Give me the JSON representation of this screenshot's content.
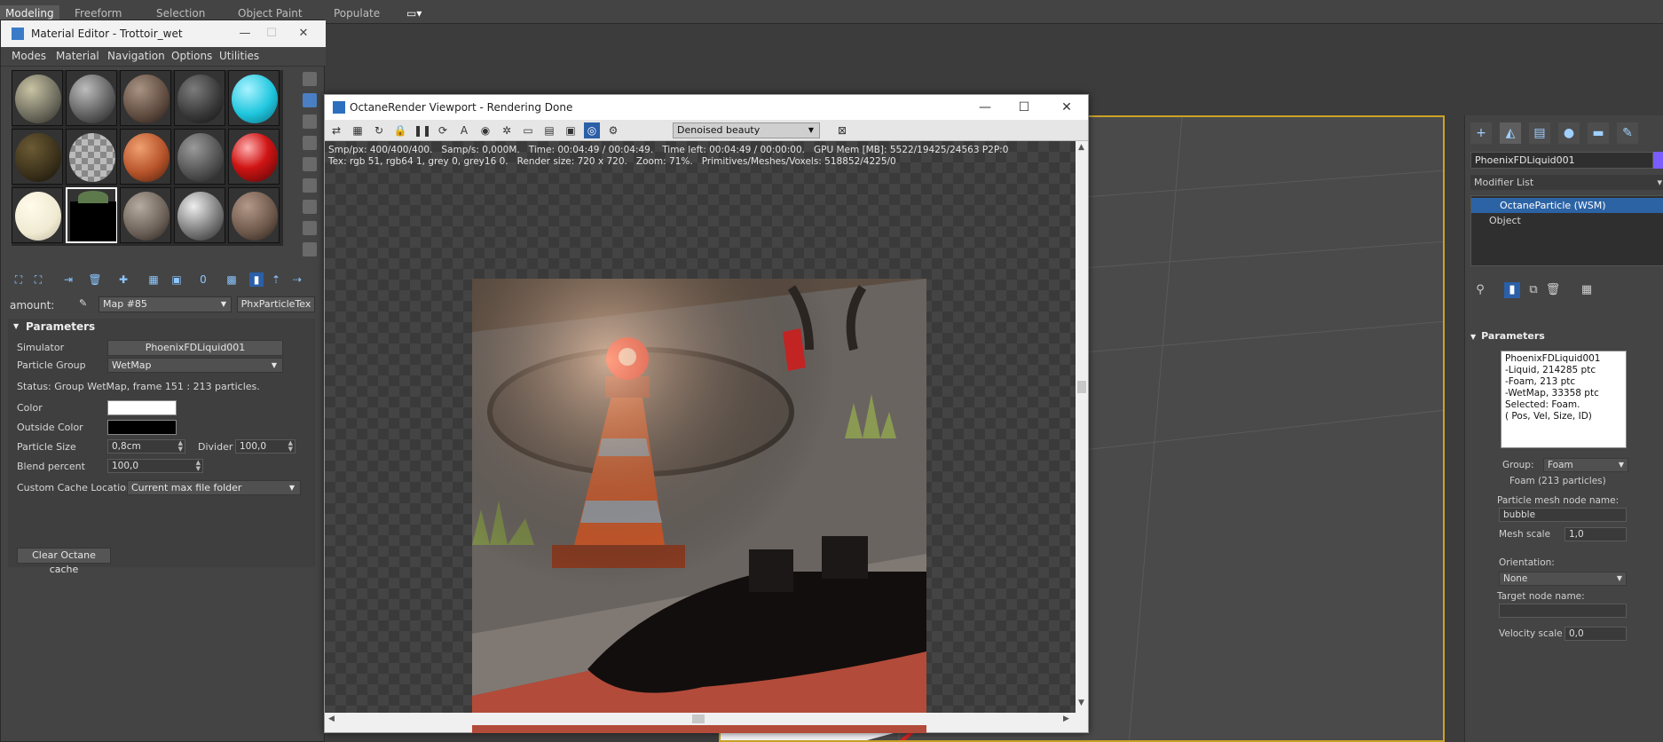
{
  "ribbon": {
    "tabs": [
      "Modeling",
      "Freeform",
      "Selection",
      "Object Paint",
      "Populate"
    ]
  },
  "material_editor": {
    "title": "Material Editor - Trottoir_wet",
    "menu": [
      "Modes",
      "Material",
      "Navigation",
      "Options",
      "Utilities"
    ],
    "amount_label": "amount:",
    "map_name": "Map #85",
    "map_type_button": "PhxParticleTex",
    "params_header": "Parameters",
    "simulator_label": "Simulator",
    "simulator_value": "PhoenixFDLiquid001",
    "particle_group_label": "Particle Group",
    "particle_group_value": "WetMap",
    "status_text": "Status: Group WetMap, frame 151 : 213 particles.",
    "color_label": "Color",
    "outside_color_label": "Outside Color",
    "particle_size_label": "Particle Size",
    "particle_size_value": "0,8cm",
    "divider_label": "Divider",
    "divider_value": "100,0",
    "blend_percent_label": "Blend percent",
    "blend_percent_value": "100,0",
    "cache_location_label": "Custom Cache Location",
    "cache_location_value": "Current max file folder",
    "clear_cache_button": "Clear Octane cache",
    "colors": {
      "color_swatch": "#ffffff",
      "outside_color_swatch": "#000000"
    }
  },
  "octane": {
    "title": "OctaneRender Viewport - Rendering Done",
    "pass_dropdown": "Denoised beauty",
    "stats_line1": "Smp/px: 400/400/400.   Samp/s: 0,000M.   Time: 00:04:49 / 00:04:49.   Time left: 00:04:49 / 00:00:00.   GPU Mem [MB]: 5522/19425/24563 P2P:0",
    "stats_line2": "Tex: rgb 51, rgb64 1, grey 0, grey16 0.   Render size: 720 x 720.   Zoom: 71%.   Primitives/Meshes/Voxels: 518852/4225/0"
  },
  "command_panel": {
    "object_name": "PhoenixFDLiquid001",
    "modifier_list_label": "Modifier List",
    "stack": [
      "OctaneParticle (WSM)",
      "Object"
    ],
    "params_header": "Parameters",
    "info_text": "PhoenixFDLiquid001\n-Liquid, 214285 ptc\n-Foam, 213 ptc\n-WetMap, 33358 ptc\nSelected: Foam.\n( Pos, Vel, Size, ID)",
    "group_label": "Group:",
    "group_value": "Foam",
    "group_count": "Foam (213 particles)",
    "mesh_node_label": "Particle mesh node name:",
    "mesh_node_value": "bubble",
    "mesh_scale_label": "Mesh scale",
    "mesh_scale_value": "1,0",
    "orientation_label": "Orientation:",
    "orientation_value": "None",
    "target_node_label": "Target node name:",
    "target_node_value": "",
    "velocity_scale_label": "Velocity scale",
    "velocity_scale_value": "0,0",
    "accent": "#7a5cff"
  }
}
